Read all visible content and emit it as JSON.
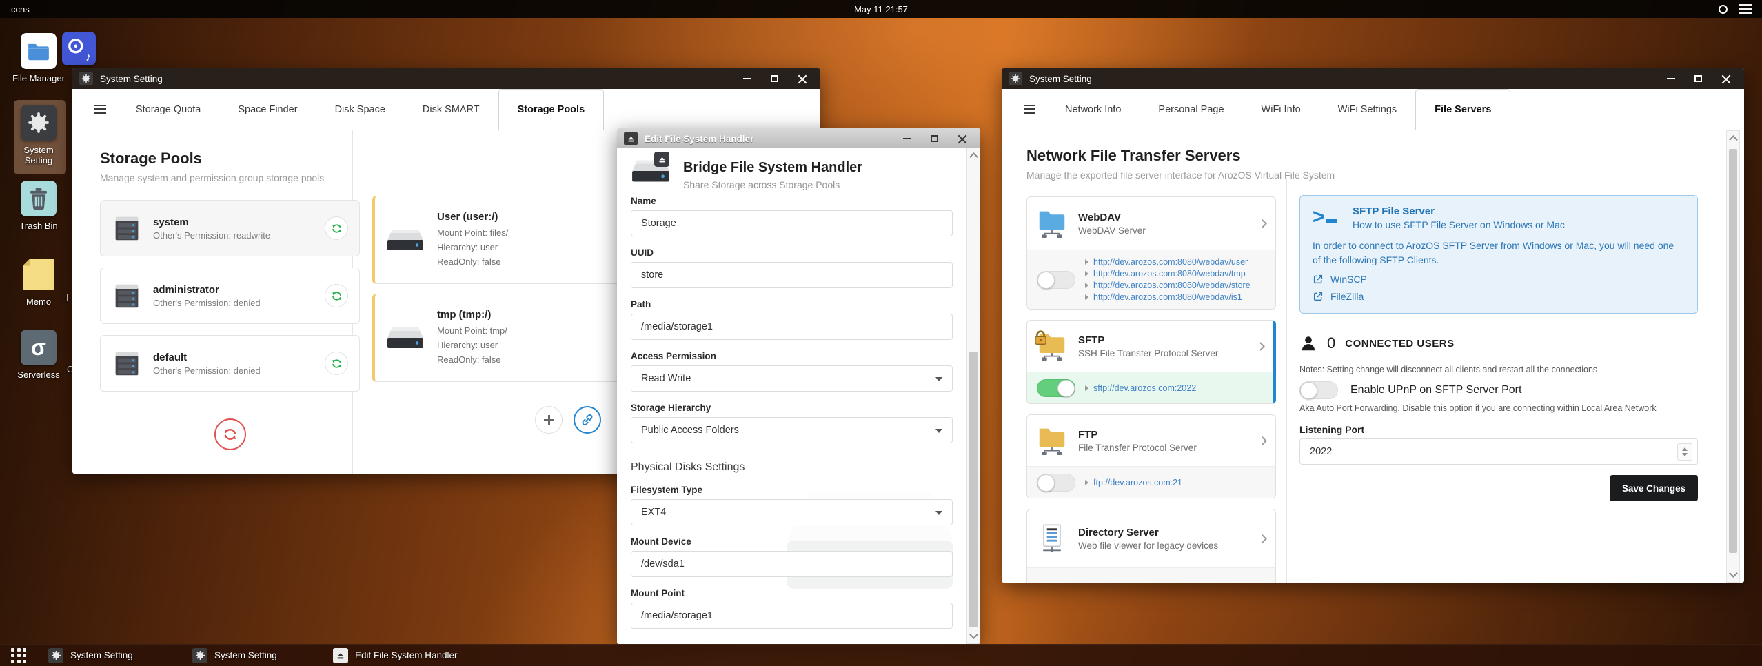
{
  "topbar": {
    "host": "ccns",
    "clock": "May 11 21:57"
  },
  "desktop": {
    "icons": [
      {
        "label": "File Manager"
      },
      {
        "label": "System Setting"
      },
      {
        "label": "Trash Bin"
      },
      {
        "label": "Memo"
      },
      {
        "label": "Serverless"
      }
    ],
    "music_note": "♪",
    "serverless_glyph": "σ",
    "partial_labels": [
      "I",
      "C"
    ]
  },
  "win_storage": {
    "title": "System Setting",
    "tabs": [
      "Storage Quota",
      "Space Finder",
      "Disk Space",
      "Disk SMART",
      "Storage Pools"
    ],
    "heading": "Storage Pools",
    "subheading": "Manage system and permission group storage pools",
    "pools": [
      {
        "name": "system",
        "permission": "Other's Permission: readwrite"
      },
      {
        "name": "administrator",
        "permission": "Other's Permission: denied"
      },
      {
        "name": "default",
        "permission": "Other's Permission: denied"
      }
    ],
    "mounts": [
      {
        "name": "User (user:/)",
        "lines": [
          "Mount Point: files/",
          "Hierarchy: user",
          "ReadOnly: false"
        ]
      },
      {
        "name": "tmp (tmp:/)",
        "lines": [
          "Mount Point: tmp/",
          "Hierarchy: user",
          "ReadOnly: false"
        ]
      }
    ]
  },
  "win_edit": {
    "title": "Edit File System Handler",
    "heading": "Bridge File System Handler",
    "subheading": "Share Storage across Storage Pools",
    "fields": {
      "name_label": "Name",
      "name_value": "Storage",
      "uuid_label": "UUID",
      "uuid_value": "store",
      "path_label": "Path",
      "path_value": "/media/storage1",
      "access_label": "Access Permission",
      "access_value": "Read Write",
      "hierarchy_label": "Storage Hierarchy",
      "hierarchy_value": "Public Access Folders",
      "section": "Physical Disks Settings",
      "fstype_label": "Filesystem Type",
      "fstype_value": "EXT4",
      "mount_device_label": "Mount Device",
      "mount_device_value": "/dev/sda1",
      "mount_point_label": "Mount Point",
      "mount_point_value": "/media/storage1"
    }
  },
  "win_servers": {
    "title": "System Setting",
    "tabs": [
      "Network Info",
      "Personal Page",
      "WiFi Info",
      "WiFi Settings",
      "File Servers"
    ],
    "heading": "Network File Transfer Servers",
    "subheading": "Manage the exported file server interface for ArozOS Virtual File System",
    "webdav": {
      "name": "WebDAV",
      "desc": "WebDAV Server",
      "enabled": false,
      "urls": [
        "http://dev.arozos.com:8080/webdav/user",
        "http://dev.arozos.com:8080/webdav/tmp",
        "http://dev.arozos.com:8080/webdav/store",
        "http://dev.arozos.com:8080/webdav/is1"
      ]
    },
    "sftp": {
      "name": "SFTP",
      "desc": "SSH File Transfer Protocol Server",
      "url": "sftp://dev.arozos.com:2022",
      "enabled": true
    },
    "ftp": {
      "name": "FTP",
      "desc": "File Transfer Protocol Server",
      "url": "ftp://dev.arozos.com:21",
      "enabled": false
    },
    "directory": {
      "name": "Directory Server",
      "desc": "Web file viewer for legacy devices"
    },
    "info": {
      "title": "SFTP File Server",
      "subtitle": "How to use SFTP File Server on Windows or Mac",
      "body": "In order to connect to ArozOS SFTP Server from Windows or Mac, you will need one of the following SFTP Clients.",
      "clients": [
        "WinSCP",
        "FileZilla"
      ]
    },
    "connected": {
      "count": "0",
      "label": "CONNECTED USERS",
      "notes": "Notes: Setting change will disconnect all clients and restart all the connections"
    },
    "upnp": {
      "label": "Enable UPnP on SFTP Server Port",
      "desc": "Aka Auto Port Forwarding. Disable this option if you are connecting within Local Area Network",
      "enabled": false
    },
    "port": {
      "label": "Listening Port",
      "value": "2022"
    },
    "save_label": "Save Changes"
  },
  "taskbar": {
    "items": [
      "System Setting",
      "System Setting",
      "Edit File System Handler"
    ]
  },
  "colors": {
    "accent_blue": "#2185d0",
    "link_blue": "#4183c4",
    "toggle_green": "#63cf7d",
    "sftp_row_green": "#e9f8ee",
    "info_bg": "#e7f2fb",
    "info_border": "#9cc8ec",
    "save_button_bg": "#1b1c1d",
    "mount_card_edge": "#f3ca6b",
    "refresh_red": "#e05252"
  }
}
